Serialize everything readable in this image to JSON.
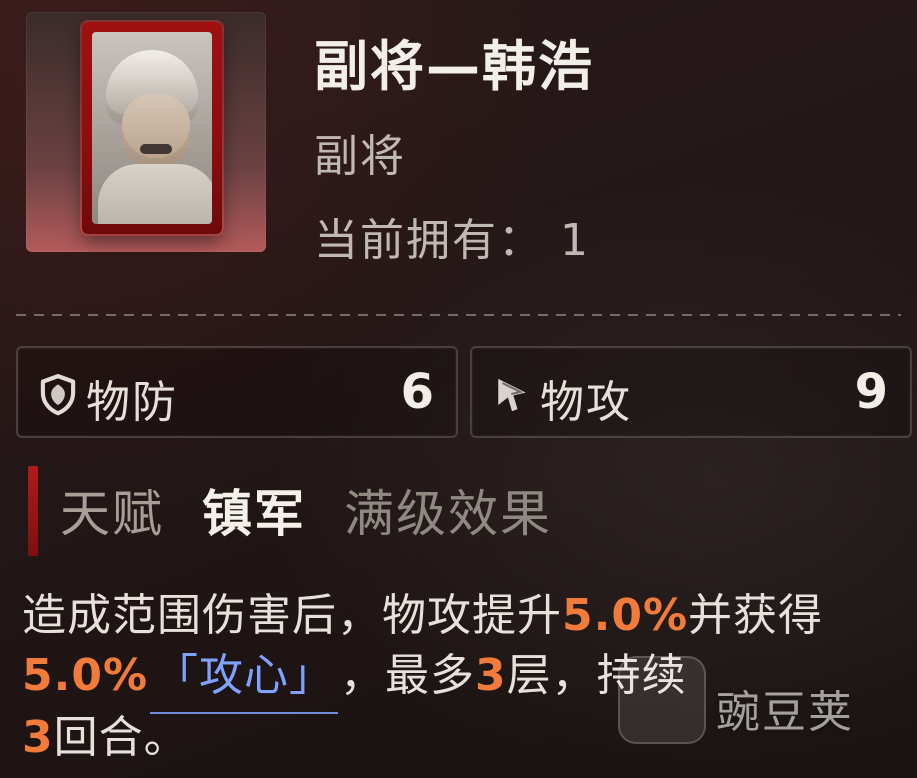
{
  "header": {
    "title": "副将—韩浩",
    "subtitle": "副将",
    "owned_label": "当前拥有：",
    "owned_value": "1"
  },
  "stats": [
    {
      "icon": "shield-icon",
      "label": "物防",
      "value": "6"
    },
    {
      "icon": "cursor-icon",
      "label": "物攻",
      "value": "9"
    }
  ],
  "talent": {
    "label": "天赋",
    "name": "镇军",
    "effect_title": "满级效果"
  },
  "description": {
    "part1": "造成范围伤害后，物攻提升",
    "val1": "5.0%",
    "part2": "并获得",
    "val2": "5.0%",
    "tag": "「攻心」",
    "part3": "，最多",
    "val3": "3",
    "part4": "层，持续",
    "val4": "3",
    "part5": "回合。"
  },
  "watermark": {
    "text": "豌豆荚"
  },
  "colors": {
    "accent_red": "#b21b1b",
    "value_orange": "#f07b3a",
    "tag_blue": "#7fa1ff"
  }
}
